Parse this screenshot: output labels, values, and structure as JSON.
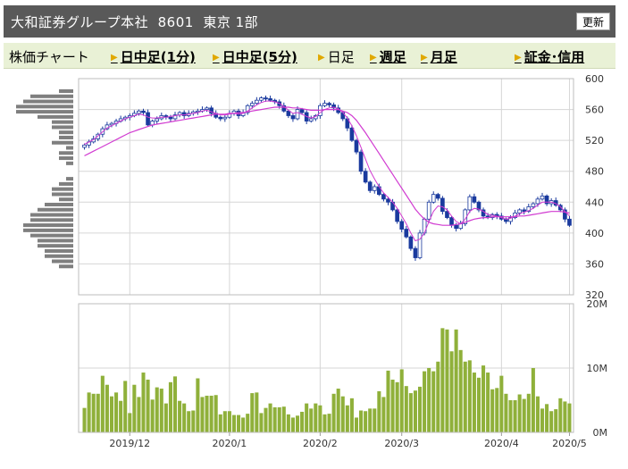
{
  "header": {
    "title": "大和証券グループ本社  8601  東京 1部",
    "refresh_label": "更新"
  },
  "tabs": [
    {
      "label": "株価チャート",
      "link": false,
      "arrow": false
    },
    {
      "label": "日中足(1分)",
      "link": true,
      "arrow": true
    },
    {
      "label": "日中足(5分)",
      "link": true,
      "arrow": true
    },
    {
      "label": "日足",
      "link": false,
      "arrow": true
    },
    {
      "label": "週足",
      "link": true,
      "arrow": true
    },
    {
      "label": "月足",
      "link": true,
      "arrow": true
    },
    {
      "label": "証金･信用",
      "link": true,
      "arrow": true
    }
  ],
  "colors": {
    "up": "#1a3a9e",
    "down": "#1a3a9e",
    "ma_short": "#5a6fa8",
    "ma_long": "#d13bd1",
    "volume": "#8fb03a",
    "profile": "#7f7f7f",
    "grid": "#d6d6d6"
  },
  "chart_data": [
    {
      "type": "candlestick",
      "y_ticks": [
        320,
        360,
        400,
        440,
        480,
        520,
        560,
        600
      ],
      "ylim": [
        320,
        600
      ],
      "x_labels": [
        "2019/12",
        "2020/1",
        "2020/2",
        "2020/3",
        "2020/4",
        "2020/5"
      ],
      "grid": true,
      "close": [
        514,
        518,
        522,
        528,
        535,
        540,
        542,
        545,
        548,
        550,
        552,
        555,
        558,
        556,
        540,
        545,
        548,
        552,
        550,
        548,
        553,
        556,
        552,
        555,
        557,
        558,
        560,
        562,
        555,
        550,
        548,
        550,
        555,
        558,
        552,
        556,
        565,
        568,
        572,
        575,
        574,
        572,
        570,
        565,
        558,
        552,
        548,
        560,
        556,
        545,
        548,
        552,
        565,
        568,
        566,
        562,
        556,
        548,
        536,
        520,
        505,
        480,
        466,
        455,
        460,
        450,
        444,
        440,
        430,
        415,
        405,
        395,
        380,
        368,
        400,
        418,
        440,
        450,
        445,
        428,
        420,
        410,
        406,
        412,
        430,
        447,
        440,
        430,
        422,
        420,
        424,
        422,
        418,
        415,
        420,
        426,
        430,
        428,
        434,
        438,
        444,
        448,
        438,
        442,
        436,
        430,
        418,
        410
      ],
      "ma_short": [
        515,
        518,
        521,
        526,
        531,
        536,
        539,
        542,
        545,
        548,
        550,
        552,
        554,
        553,
        550,
        549,
        549,
        550,
        550,
        551,
        552,
        553,
        553,
        554,
        555,
        556,
        558,
        559,
        557,
        555,
        553,
        553,
        554,
        555,
        554,
        555,
        558,
        562,
        566,
        569,
        571,
        571,
        570,
        568,
        564,
        559,
        555,
        556,
        554,
        551,
        549,
        551,
        556,
        560,
        562,
        563,
        561,
        556,
        549,
        539,
        526,
        511,
        496,
        481,
        470,
        460,
        452,
        446,
        440,
        432,
        422,
        412,
        400,
        390,
        392,
        400,
        415,
        428,
        435,
        434,
        430,
        422,
        415,
        412,
        418,
        428,
        432,
        431,
        428,
        424,
        423,
        422,
        420,
        418,
        419,
        422,
        425,
        427,
        429,
        432,
        436,
        440,
        440,
        440,
        438,
        434,
        428,
        422
      ],
      "ma_long": [
        500,
        503,
        506,
        509,
        512,
        515,
        518,
        521,
        524,
        527,
        530,
        532,
        534,
        536,
        538,
        540,
        541,
        542,
        543,
        544,
        545,
        546,
        547,
        548,
        549,
        550,
        551,
        552,
        553,
        554,
        554,
        554,
        555,
        555,
        556,
        556,
        557,
        558,
        559,
        560,
        561,
        562,
        563,
        563,
        563,
        563,
        562,
        562,
        561,
        560,
        559,
        559,
        559,
        560,
        560,
        560,
        560,
        558,
        556,
        552,
        546,
        538,
        530,
        521,
        512,
        503,
        494,
        485,
        476,
        467,
        458,
        449,
        440,
        431,
        424,
        418,
        414,
        412,
        411,
        410,
        410,
        410,
        411,
        412,
        414,
        416,
        418,
        419,
        420,
        420,
        421,
        421,
        421,
        421,
        421,
        421,
        422,
        422,
        423,
        424,
        425,
        426,
        427,
        428,
        428,
        428,
        427,
        426
      ]
    },
    {
      "type": "bar",
      "title": "volume",
      "y_ticks": [
        "0M",
        "10M",
        "20M"
      ],
      "ylim": [
        0,
        20
      ],
      "values": [
        3.8,
        6.2,
        6,
        6,
        8.8,
        7.4,
        5.6,
        6.2,
        4.9,
        8,
        3,
        7.4,
        5.5,
        9.3,
        8.2,
        5.1,
        7,
        6.8,
        4.5,
        7.8,
        8.7,
        4.9,
        4.5,
        3.3,
        3.4,
        8.4,
        5.5,
        5.7,
        5.7,
        5.8,
        2.8,
        3.3,
        3.3,
        2.7,
        2.7,
        2.3,
        2.9,
        6.1,
        6.2,
        3,
        3.8,
        4.5,
        3.9,
        3.9,
        4,
        2.8,
        2.3,
        2.6,
        3.2,
        4.5,
        3.7,
        4.5,
        4.2,
        2.8,
        2.9,
        6,
        6.8,
        5.6,
        4.2,
        5.3,
        2.3,
        3.4,
        3.3,
        3.7,
        3.7,
        6.4,
        5.5,
        9.6,
        8.2,
        7.8,
        9.8,
        7.2,
        6.1,
        6.5,
        7.1,
        9.5,
        10,
        9.5,
        11,
        16.2,
        16,
        12.6,
        16,
        12.8,
        11,
        11.2,
        9.3,
        8.5,
        10.4,
        9.3,
        6.7,
        6.9,
        8.8,
        6,
        5,
        5,
        5.9,
        5.2,
        6,
        10,
        5.6,
        3.7,
        4.4,
        3.3,
        3.6,
        5.3,
        4.8,
        4.5,
        3.8,
        5.8,
        5.3,
        4.2,
        4.2,
        3.3,
        8.4,
        7.8,
        6,
        4.2,
        8.2,
        5.3,
        3.5,
        6.4,
        6.3
      ]
    },
    {
      "type": "bar",
      "title": "price-volume profile",
      "values": [
        2,
        6,
        7,
        8,
        8,
        5,
        3,
        3,
        2,
        2,
        3,
        1,
        2,
        2,
        1,
        0,
        0,
        1,
        2,
        3,
        3,
        2,
        4,
        5,
        6,
        6,
        7,
        7,
        6,
        5,
        5,
        4,
        4,
        3,
        2
      ]
    }
  ]
}
